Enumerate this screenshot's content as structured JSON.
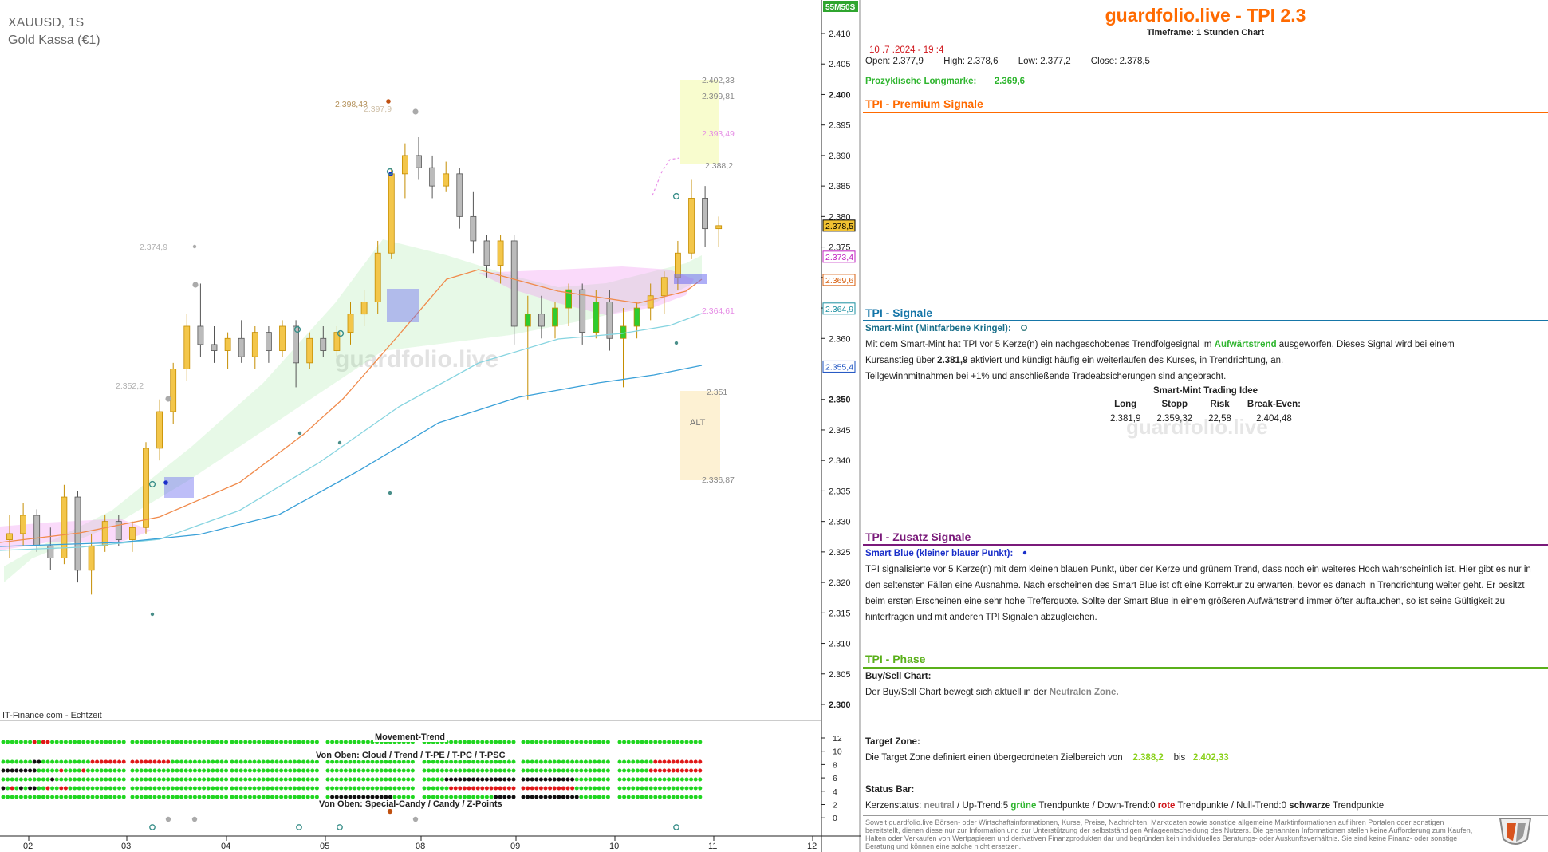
{
  "chart": {
    "symbol": "XAUUSD, 1S",
    "name": "Gold Kassa (€1)",
    "source": "IT-Finance.com - Echtzeit",
    "countdown": "55M50S",
    "watermark": "guardfolio.live",
    "annotations": {
      "a239843": "2.398,43",
      "a2397": "2.397,9",
      "a23749": "2.374,9",
      "a23522": "2.352,2",
      "a240233": "2.402,33",
      "a239981": "2.399,81",
      "a239349": "2.393,49",
      "a23882": "2.388,2",
      "a236461": "2.364,61",
      "a2351": "2.351",
      "a233687": "2.336,87",
      "alt": "ALT"
    },
    "price_tags": {
      "current": "2.378,5",
      "magenta": "2.373,4",
      "orange": "2.369,6",
      "teal": "2.364,9",
      "blue": "2.355,4"
    },
    "colors": {
      "up": "#f3c64a",
      "down": "#888888",
      "green": "#2ecc2e",
      "orange_ma": "#f08a4b",
      "teal_ma": "#86d4e0",
      "blue_ma": "#3aa0d8",
      "accent": "#ff6a00"
    }
  },
  "chart_data": {
    "type": "candlestick",
    "instrument": "XAUUSD",
    "timeframe": "1S",
    "x_tick_labels": [
      "02",
      "03",
      "04",
      "05",
      "08",
      "09",
      "10",
      "11",
      "12"
    ],
    "y_ticks": [
      2300,
      2305,
      2310,
      2315,
      2320,
      2325,
      2330,
      2335,
      2340,
      2345,
      2350,
      2355,
      2360,
      2365,
      2370,
      2375,
      2380,
      2385,
      2390,
      2395,
      2400,
      2405,
      2410
    ],
    "y_tick_labels": [
      "2.300",
      "2.305",
      "2.310",
      "2.315",
      "2.320",
      "2.325",
      "2.330",
      "2.335",
      "2.340",
      "2.345",
      "2.350",
      "2.355",
      "2.360",
      "2.365",
      "2.370",
      "2.375",
      "2.380",
      "2.385",
      "2.390",
      "2.395",
      "2.400",
      "2.405",
      "2.410"
    ],
    "ylim": [
      2297,
      2413
    ],
    "grid": false,
    "ohlc": [
      [
        2327,
        2331,
        2324,
        2328
      ],
      [
        2328,
        2333,
        2326,
        2331
      ],
      [
        2331,
        2332,
        2325,
        2326
      ],
      [
        2326,
        2329,
        2322,
        2324
      ],
      [
        2324,
        2336,
        2323,
        2334
      ],
      [
        2334,
        2335,
        2320,
        2322
      ],
      [
        2322,
        2328,
        2318,
        2326
      ],
      [
        2326,
        2331,
        2325,
        2330
      ],
      [
        2330,
        2331,
        2326,
        2327
      ],
      [
        2327,
        2330,
        2325,
        2329
      ],
      [
        2329,
        2343,
        2328,
        2342
      ],
      [
        2342,
        2350,
        2340,
        2348
      ],
      [
        2348,
        2356,
        2346,
        2355
      ],
      [
        2355,
        2364,
        2353,
        2362
      ],
      [
        2362,
        2369,
        2357,
        2359
      ],
      [
        2359,
        2362,
        2356,
        2358
      ],
      [
        2358,
        2361,
        2355,
        2360
      ],
      [
        2360,
        2363,
        2356,
        2357
      ],
      [
        2357,
        2362,
        2355,
        2361
      ],
      [
        2361,
        2362,
        2356,
        2358
      ],
      [
        2358,
        2363,
        2357,
        2362
      ],
      [
        2362,
        2363,
        2352,
        2356
      ],
      [
        2356,
        2361,
        2355,
        2360
      ],
      [
        2360,
        2362,
        2357,
        2358
      ],
      [
        2358,
        2362,
        2357,
        2361
      ],
      [
        2361,
        2366,
        2359,
        2364
      ],
      [
        2364,
        2368,
        2362,
        2366
      ],
      [
        2366,
        2376,
        2364,
        2374
      ],
      [
        2374,
        2388,
        2373,
        2387
      ],
      [
        2387,
        2392,
        2383,
        2390
      ],
      [
        2390,
        2393,
        2386,
        2388
      ],
      [
        2388,
        2390,
        2383,
        2385
      ],
      [
        2385,
        2389,
        2384,
        2387
      ],
      [
        2387,
        2388,
        2378,
        2380
      ],
      [
        2380,
        2384,
        2374,
        2376
      ],
      [
        2376,
        2377,
        2370,
        2372
      ],
      [
        2372,
        2377,
        2369,
        2376
      ],
      [
        2376,
        2377,
        2359,
        2362
      ],
      [
        2362,
        2367,
        2350,
        2364
      ],
      [
        2364,
        2367,
        2360,
        2362
      ],
      [
        2362,
        2366,
        2360,
        2365
      ],
      [
        2365,
        2369,
        2362,
        2368
      ],
      [
        2368,
        2369,
        2359,
        2361
      ],
      [
        2361,
        2368,
        2360,
        2366
      ],
      [
        2366,
        2368,
        2358,
        2360
      ],
      [
        2360,
        2365,
        2352,
        2362
      ],
      [
        2362,
        2366,
        2360,
        2365
      ],
      [
        2365,
        2369,
        2363,
        2367
      ],
      [
        2367,
        2371,
        2364,
        2370
      ],
      [
        2370,
        2376,
        2368,
        2374
      ],
      [
        2374,
        2386,
        2373,
        2383
      ],
      [
        2383,
        2385,
        2375,
        2378
      ],
      [
        2378,
        2380,
        2375,
        2378.5
      ]
    ],
    "moving_averages": [
      {
        "color": "orange",
        "last": 2369.6
      },
      {
        "color": "teal",
        "last": 2364.9
      },
      {
        "color": "blue",
        "last": 2355.4
      }
    ]
  },
  "movement_trend": {
    "title": "Movement-Trend",
    "subtitle_top": "Von Oben: Cloud / Trend / T-PE / T-PC / T-PSC",
    "subtitle_bottom": "Von Oben: Special-Candy / Candy / Z-Points",
    "scale": [
      "12",
      "10",
      "8",
      "6",
      "4",
      "2",
      "0"
    ]
  },
  "info": {
    "brand": "guardfolio.live - TPI 2.3",
    "timeframe": "Timeframe: 1 Stunden Chart",
    "datetime": "10 .7 .2024  - 19 :4",
    "open": "Open:  2.377,9",
    "high": "High:  2.378,6",
    "low": "Low:   2.377,2",
    "close": "Close:  2.378,5",
    "longmarke_label": "Prozyklische Longmarke:",
    "longmarke_value": "2.369,6",
    "premium_title": "TPI - Premium Signale",
    "signale_title": "TPI - Signale",
    "smart_mint_label": "Smart-Mint (Mintfarbene Kringel):",
    "smart_mint_text_1": "Mit dem Smart-Mint hat TPI vor 5  Kerze(n) ein nachgeschobenes Trendfolgesignal im ",
    "smart_mint_trend": "Aufwärtstrend",
    "smart_mint_text_2": " ausgeworfen. Dieses Signal wird bei einem",
    "smart_mint_text_3": "Kursanstieg über ",
    "smart_mint_level": "2.381,9",
    "smart_mint_text_4": "    aktiviert und kündigt häufig ein weiterlaufen des Kurses, in Trendrichtung, an.",
    "smart_mint_text_5": "Teilgewinnmitnahmen bei +1% und anschließende Tradeabsicherungen sind angebracht.",
    "idea_title": "Smart-Mint Trading Idee",
    "idea_headers": [
      "Long",
      "Stopp",
      "Risk",
      "Break-Even:"
    ],
    "idea_values": [
      "2.381,9",
      "2.359,32",
      "22,58",
      "2.404,48"
    ],
    "zusatz_title": "TPI - Zusatz Signale",
    "smart_blue_label": "Smart Blue (kleiner blauer Punkt):",
    "smart_blue_text": "TPI signalisierte vor 5  Kerze(n) mit dem kleinen blauen Punkt, über der Kerze und grünem Trend, dass noch ein weiteres Hoch wahrscheinlich ist. Hier gibt es nur in den seltensten Fällen eine Ausnahme. Nach erscheinen des Smart Blue ist oft eine Korrektur zu erwarten, bevor es danach in Trendrichtung weiter geht. Er besitzt beim ersten Erscheinen eine sehr hohe Trefferquote. Sollte der Smart Blue in einem größeren Aufwärtstrend immer öfter auftauchen, so ist seine Gültigkeit zu hinterfragen und mit anderen TPI Signalen abzugleichen.",
    "phase_title": "TPI - Phase",
    "buysell_label": "Buy/Sell Chart:",
    "buysell_text": "Der Buy/Sell Chart bewegt sich aktuell in der ",
    "buysell_zone": "Neutralen Zone.",
    "target_label": "Target Zone:",
    "target_text": "Die Target Zone definiert einen übergeordneten Zielbereich von ",
    "target_from": "2.388,2",
    "target_bis": "bis",
    "target_to": "2.402,33",
    "status_label": "Status Bar:",
    "status_prefix": "Kerzenstatus: ",
    "status_neutral": "neutral",
    "status_up": " / Up-Trend:5 ",
    "status_green": "grüne",
    "status_tp1": " Trendpunkte  / Down-Trend:0 ",
    "status_red": "rote",
    "status_tp2": " Trendpunkte / Null-Trend:0 ",
    "status_black": "schwarze",
    "status_tp3": " Trendpunkte",
    "disclaimer": "Soweit guardfolio.live Börsen- oder Wirtschaftsinformationen, Kurse, Preise, Nachrichten, Marktdaten sowie sonstige allgemeine Marktinformationen auf ihren Portalen oder sonstigen bereitstellt, dienen diese nur zur Information und zur Unterstützung der selbstständigen Anlageentscheidung des Nutzers. Die genannten Informationen stellen keine Aufforderung zum Kaufen, Halten oder Verkaufen von Wertpapieren und derivativen Finanzprodukten dar und begründen kein individuelles Beratungs- oder Auskunftsverhältnis. Sie sind keine Finanz- oder sonstige Beratung und können eine solche nicht ersetzen.",
    "watermark": "guardfolio.live"
  }
}
